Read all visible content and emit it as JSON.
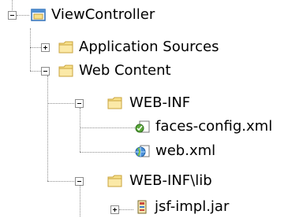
{
  "tree": {
    "root": {
      "label": "ViewController",
      "icon": "project-icon",
      "state": "expanded"
    },
    "application_sources": {
      "label": "Application Sources",
      "icon": "folder-icon",
      "state": "collapsed"
    },
    "web_content": {
      "label": "Web Content",
      "icon": "folder-icon",
      "state": "expanded"
    },
    "web_inf": {
      "label": "WEB-INF",
      "icon": "folder-icon",
      "state": "expanded"
    },
    "faces_config": {
      "label": "faces-config.xml",
      "icon": "faces-config-file-icon"
    },
    "web_xml": {
      "label": "web.xml",
      "icon": "web-xml-file-icon"
    },
    "web_inf_lib": {
      "label": "WEB-INF\\lib",
      "icon": "folder-icon",
      "state": "expanded"
    },
    "jsf_impl": {
      "label": "jsf-impl.jar",
      "icon": "jar-file-icon",
      "state": "collapsed"
    }
  },
  "colors": {
    "connector": "#8c8c8c",
    "folder_fill": "#f7e08a",
    "folder_edge": "#c9a33d",
    "project_edge": "#2f6fb5"
  }
}
